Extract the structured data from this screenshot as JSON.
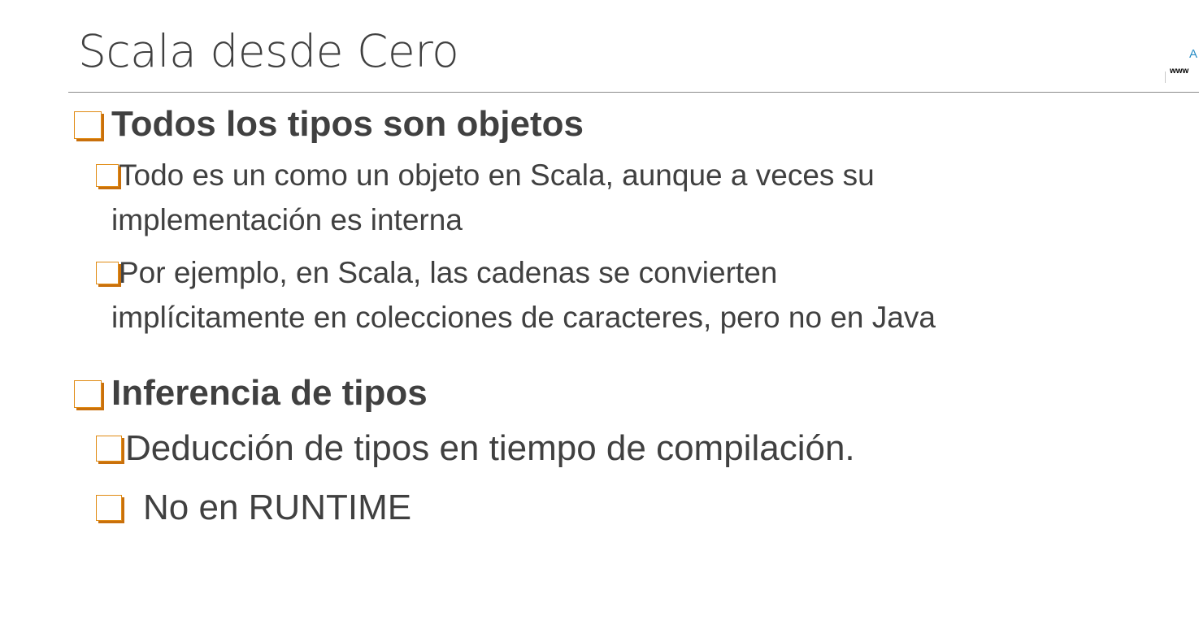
{
  "slide": {
    "title": "Scala desde Cero",
    "logo": {
      "letter": "A",
      "web": "www"
    },
    "sections": [
      {
        "heading": "Todos los tipos son objetos",
        "points": [
          {
            "line1": "Todo es un como un objeto en Scala, aunque a veces su",
            "line2": "implementación es interna"
          },
          {
            "line1": "Por ejemplo, en Scala, las cadenas se convierten",
            "line2": "implícitamente en colecciones de caracteres, pero no en Java"
          }
        ]
      },
      {
        "heading": "Inferencia de tipos",
        "points": [
          {
            "line1": "Deducción de tipos en tiempo de compilación."
          },
          {
            "line1": "No en RUNTIME"
          }
        ]
      }
    ]
  },
  "colors": {
    "text": "#404040",
    "bullet_border": "#e08b14",
    "bullet_shadow": "#c9700c",
    "rule": "#8c8c8c"
  }
}
